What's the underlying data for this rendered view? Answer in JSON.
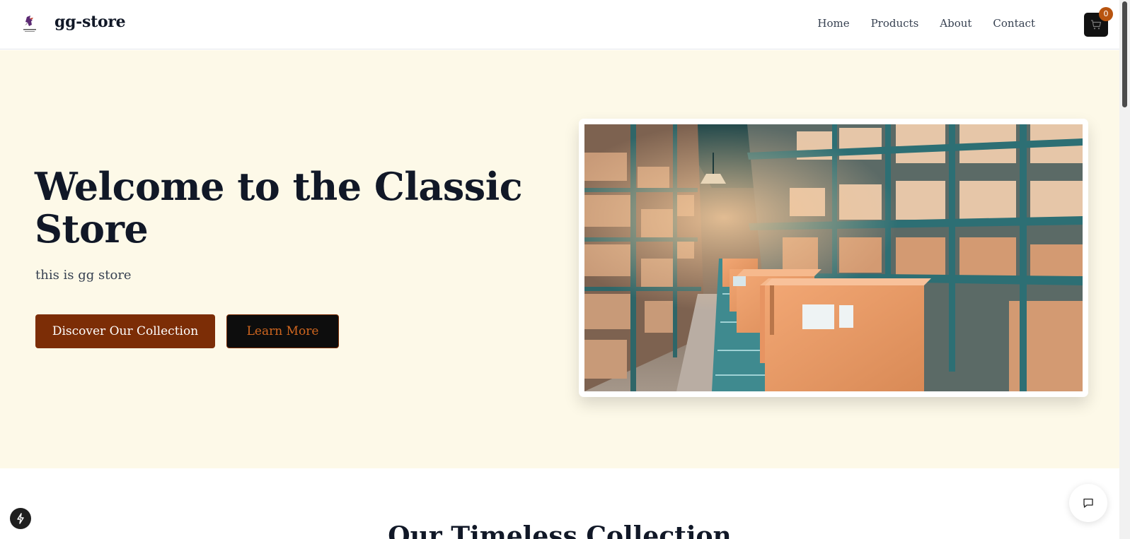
{
  "header": {
    "brand": "gg-store",
    "logo_icon": "bird-logo-icon",
    "nav": [
      {
        "label": "Home"
      },
      {
        "label": "Products"
      },
      {
        "label": "About"
      },
      {
        "label": "Contact"
      }
    ],
    "cart": {
      "icon": "shopping-cart-icon",
      "count": "0"
    }
  },
  "hero": {
    "title": "Welcome to the Classic Store",
    "subtitle": "this is gg store",
    "primary_button": "Discover Our Collection",
    "secondary_button": "Learn More",
    "image_icon": "warehouse-photo"
  },
  "collection": {
    "title": "Our Timeless Collection"
  },
  "widgets": {
    "dev_icon": "lightning-icon",
    "chat_icon": "chat-bubble-icon"
  },
  "colors": {
    "hero_background": "#fdf9e8",
    "primary": "#7c2d06",
    "accent": "#b8540f",
    "dark": "#0d0d0d",
    "text": "#111827"
  }
}
